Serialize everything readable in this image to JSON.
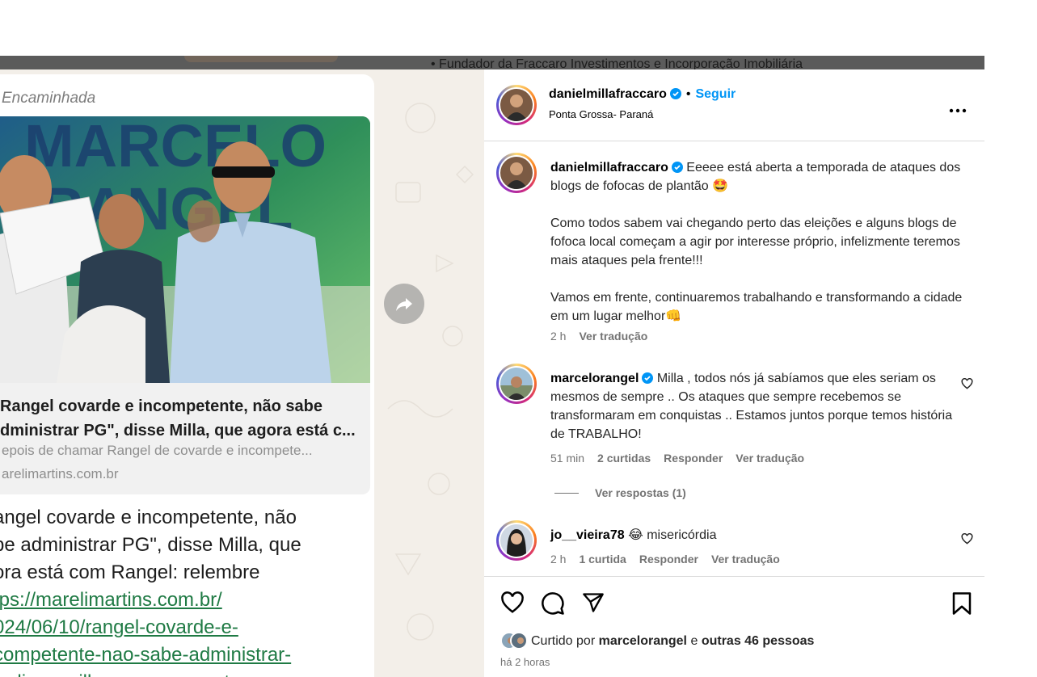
{
  "background_strip": {
    "text": "• Fundador da Fraccaro Investimentos e Incorporação Imobiliária"
  },
  "media": {
    "forwarded_label": "Encaminhada",
    "banner_letters": "MARCELO RANGEL",
    "card_title_line1": "Rangel covarde e incompetente, não sabe",
    "card_title_line2": "dministrar PG\", disse Milla, que agora está c...",
    "card_desc": "epois de chamar Rangel de covarde e incompete...",
    "card_domain": "arelimartins.com.br",
    "msg_line1": "angel covarde e incompetente, não",
    "msg_line2": "be administrar PG\", disse Milla, que",
    "msg_line3": "ora está com Rangel: relembre",
    "link_line1": "tps://marelimartins.com.br/",
    "link_line2": "024/06/10/rangel-covarde-e-",
    "link_line3": "competente-nao-sabe-administrar-",
    "link_line4": "g-disse-milla-que-agora-esta-com-"
  },
  "post_header": {
    "username": "danielmillafraccaro",
    "follow_label": "Seguir",
    "separator": "•",
    "location": "Ponta Grossa- Paraná",
    "more_icon": "more-horizontal-icon"
  },
  "caption": {
    "username": "danielmillafraccaro",
    "text_p1": "Eeeee está aberta a temporada de ataques dos blogs de fofocas de plantão 🤩",
    "text_p2": "Como todos sabem vai chegando perto das eleições e alguns blogs de fofoca local começam a agir por interesse próprio, infelizmente teremos mais ataques pela frente!!!",
    "text_p3": "Vamos em frente, continuaremos trabalhando e transformando a cidade em um lugar melhor👊",
    "time": "2 h",
    "translate": "Ver tradução"
  },
  "comments": [
    {
      "username": "marcelorangel",
      "text": "Milla , todos nós já sabíamos que eles seriam os mesmos de sempre .. Os ataques que sempre recebemos se transformaram em conquistas .. Estamos juntos porque temos história de TRABALHO!",
      "time": "51 min",
      "likes": "2 curtidas",
      "reply": "Responder",
      "translate": "Ver tradução",
      "view_replies": "Ver respostas (1)"
    },
    {
      "username": "jo__vieira78",
      "text": "😂 misericórdia",
      "time": "2 h",
      "likes": "1 curtida",
      "reply": "Responder",
      "translate": "Ver tradução"
    }
  ],
  "likes_summary": {
    "prefix": "Curtido por",
    "user": "marcelorangel",
    "conj": "e",
    "others": "outras 46 pessoas"
  },
  "post_time": "há 2 horas",
  "colors": {
    "link_blue": "#0095f6",
    "verified_blue": "#0095f6",
    "wa_link_green": "#1f7a44",
    "meta_gray": "#737373"
  }
}
